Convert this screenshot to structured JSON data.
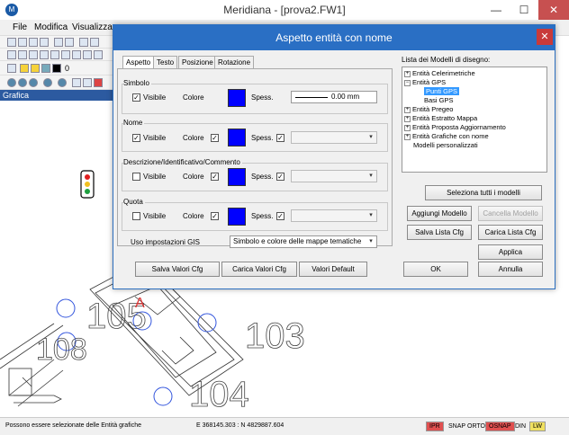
{
  "window": {
    "title": "Meridiana - [prova2.FW1]",
    "minimize": "—",
    "maximize": "☐",
    "close": "✕"
  },
  "menu": {
    "items": [
      "File",
      "Modifica",
      "Visualizza"
    ]
  },
  "toolbar": {
    "layer_value": "0"
  },
  "panels": {
    "grafica": "Grafica"
  },
  "drawing": {
    "labels": [
      "105",
      "103",
      "104",
      "108"
    ],
    "point_marker": "A"
  },
  "dialog": {
    "title": "Aspetto entità con nome",
    "close": "✕",
    "tabs": [
      "Aspetto",
      "Testo",
      "Posizione",
      "Rotazione"
    ],
    "groups": {
      "simbolo": {
        "label": "Simbolo",
        "visibile": "Visibile",
        "visibile_checked": true,
        "colore": "Colore",
        "spess": "Spess.",
        "spess_value": "0.00 mm",
        "color": "#0000ff"
      },
      "nome": {
        "label": "Nome",
        "visibile": "Visibile",
        "visibile_checked": true,
        "colore": "Colore",
        "spess": "Spess.",
        "color": "#0000ff"
      },
      "descrizione": {
        "label": "Descrizione/Identificativo/Commento",
        "visibile": "Visibile",
        "visibile_checked": false,
        "colore": "Colore",
        "spess": "Spess.",
        "color": "#0000ff"
      },
      "quota": {
        "label": "Quota",
        "visibile": "Visibile",
        "visibile_checked": false,
        "colore": "Colore",
        "spess": "Spess.",
        "color": "#0000ff"
      }
    },
    "gis": {
      "label": "Uso impostazioni GIS",
      "value": "Simbolo e colore delle mappe tematiche"
    },
    "tree": {
      "label": "Lista dei Modelli di disegno:",
      "items": [
        {
          "text": "Entità Celerimetriche",
          "exp": "+",
          "indent": 0
        },
        {
          "text": "Entità GPS",
          "exp": "−",
          "indent": 0
        },
        {
          "text": "Punti GPS",
          "exp": "",
          "indent": 1,
          "selected": true
        },
        {
          "text": "Basi GPS",
          "exp": "",
          "indent": 1
        },
        {
          "text": "Entità Pregeo",
          "exp": "+",
          "indent": 0
        },
        {
          "text": "Entità Estratto Mappa",
          "exp": "+",
          "indent": 0
        },
        {
          "text": "Entità Proposta Aggiornamento",
          "exp": "+",
          "indent": 0
        },
        {
          "text": "Entità Grafiche con nome",
          "exp": "+",
          "indent": 0
        },
        {
          "text": "Modelli personalizzati",
          "exp": "",
          "indent": 0
        }
      ]
    },
    "buttons": {
      "seleziona_tutti": "Seleziona tutti i modelli",
      "aggiungi": "Aggiungi Modello",
      "cancella": "Cancella Modello",
      "salva_lista": "Salva Lista Cfg",
      "carica_lista": "Carica Lista Cfg",
      "applica": "Applica",
      "salva_valori": "Salva Valori Cfg",
      "carica_valori": "Carica Valori Cfg",
      "valori_default": "Valori Default",
      "ok": "OK",
      "annulla": "Annulla"
    }
  },
  "status": {
    "message": "Possono essere selezionate delle Entità grafiche",
    "coords": "E 368145.303 : N 4829887.604",
    "flags": [
      "IPR",
      "SNAP",
      "ORTO",
      "OSNAP",
      "DIN",
      "LW"
    ],
    "colors": {
      "ipr": "#e05050",
      "osnap": "#e05050",
      "lw": "#f0e060"
    }
  }
}
